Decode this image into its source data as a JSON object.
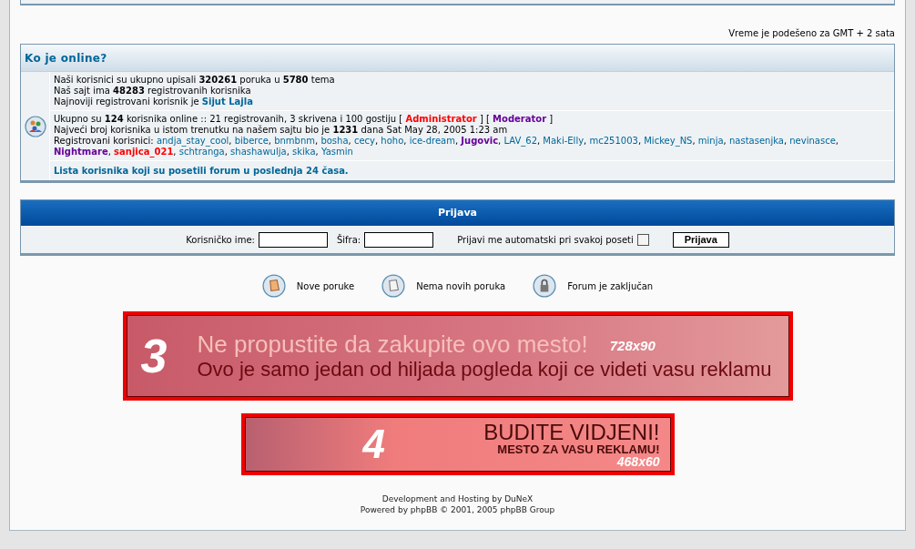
{
  "timezone_note": "Vreme je podešeno za GMT + 2 sata",
  "online": {
    "title": "Ko je online?",
    "stats": [
      "Naši korisnici su ukupno upisali **320261** poruka u **5780** tema",
      "Naš sajt ima **48283** registrovanih korisnika",
      "Najnoviji registrovani korisnik je "
    ],
    "newest_user": "Sijut Lajla",
    "online_summary": "Ukupno su **124** korisnika online :: 21 registrovanih, 3 skrivena i 100 gostiju",
    "bracket_open": "[",
    "bracket_close": "]",
    "separator": ",",
    "roles": [
      {
        "name": "Administrator",
        "kind": "admin"
      },
      {
        "name": "Moderator",
        "kind": "moderator"
      }
    ],
    "record": "Najveći broj korisnika u istom trenutku na našem sajtu bio je **1231** dana Sat May 28, 2005 1:23 am",
    "registered_label": "Registrovani korisnici:",
    "users": [
      {
        "name": "andja_stay_cool",
        "kind": "user"
      },
      {
        "name": "biberce",
        "kind": "user"
      },
      {
        "name": "bnmbnm",
        "kind": "user"
      },
      {
        "name": "bosha",
        "kind": "user"
      },
      {
        "name": "cecy",
        "kind": "user"
      },
      {
        "name": "hoho",
        "kind": "user"
      },
      {
        "name": "ice-dream",
        "kind": "user"
      },
      {
        "name": "Jugovic",
        "kind": "moderator"
      },
      {
        "name": "LAV_62",
        "kind": "user"
      },
      {
        "name": "Maki-Elly",
        "kind": "user"
      },
      {
        "name": "mc251003",
        "kind": "user"
      },
      {
        "name": "Mickey_NS",
        "kind": "user"
      },
      {
        "name": "minja",
        "kind": "user"
      },
      {
        "name": "nastasenjka",
        "kind": "user"
      },
      {
        "name": "nevinasce",
        "kind": "user"
      },
      {
        "name": "Nightmare",
        "kind": "moderator"
      },
      {
        "name": "sanjica_021",
        "kind": "admin"
      },
      {
        "name": "schtranga",
        "kind": "user"
      },
      {
        "name": "shashawulja",
        "kind": "user"
      },
      {
        "name": "skika",
        "kind": "user"
      },
      {
        "name": "Yasmin",
        "kind": "user"
      }
    ],
    "last24_link": "Lista korisnika koji su posetili forum u poslednja 24 časa."
  },
  "login": {
    "title": "Prijava",
    "username_label": "Korisničko ime:",
    "password_label": "Šifra:",
    "autologin_label": "Prijavi me automatski pri svakoj poseti",
    "autologin_checked": false,
    "submit": "Prijava"
  },
  "legend": [
    {
      "kind": "new",
      "label": "Nove poruke"
    },
    {
      "kind": "none",
      "label": "Nema novih poruka"
    },
    {
      "kind": "locked",
      "label": "Forum je zaključan"
    }
  ],
  "banners": [
    {
      "kind": "wide",
      "number": "3",
      "headline": "Ne propustite da zakupite ovo mesto!",
      "subline": "Ovo je samo jedan od hiljada pogleda koji ce videti vasu reklamu",
      "size": "728x90"
    },
    {
      "kind": "small",
      "number": "4",
      "headline": "BUDITE VIDJENI!",
      "subline": "MESTO ZA VASU REKLAMU!",
      "size": "468x60"
    }
  ],
  "footer": [
    "Development and Hosting by DuNeX",
    "Powered by phpBB © 2001, 2005 phpBB Group"
  ]
}
